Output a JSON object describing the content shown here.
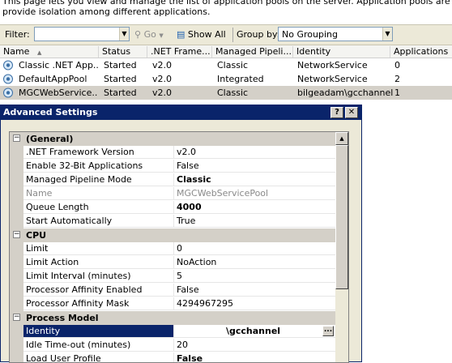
{
  "intro": {
    "line1": "This page lets you view and manage the list of application pools on the server. Application pools are associated with",
    "line2": "provide isolation among different applications."
  },
  "toolbar": {
    "filter_label": "Filter:",
    "filter_value": "",
    "go_label": "Go",
    "show_all_label": "Show All",
    "group_by_label": "Group by:",
    "group_by_value": "No Grouping"
  },
  "list": {
    "columns": [
      "Name",
      "Status",
      ".NET Frame...",
      "Managed Pipeli...",
      "Identity",
      "Applications"
    ],
    "rows": [
      {
        "name": "Classic .NET App...",
        "status": "Started",
        "framework": "v2.0",
        "pipeline": "Classic",
        "identity": "NetworkService",
        "applications": "0"
      },
      {
        "name": "DefaultAppPool",
        "status": "Started",
        "framework": "v2.0",
        "pipeline": "Integrated",
        "identity": "NetworkService",
        "applications": "2"
      },
      {
        "name": "MGCWebService...",
        "status": "Started",
        "framework": "v2.0",
        "pipeline": "Classic",
        "identity": "bilgeadam\\gcchannel",
        "applications": "1"
      }
    ]
  },
  "dialog": {
    "title": "Advanced Settings",
    "help_glyph": "?",
    "close_glyph": "✕",
    "categories": {
      "general": "(General)",
      "cpu": "CPU",
      "process_model": "Process Model"
    },
    "general": [
      {
        "name": ".NET Framework Version",
        "value": "v2.0"
      },
      {
        "name": "Enable 32-Bit Applications",
        "value": "False"
      },
      {
        "name": "Managed Pipeline Mode",
        "value": "Classic"
      },
      {
        "name": "Name",
        "value": "MGCWebServicePool"
      },
      {
        "name": "Queue Length",
        "value": "4000"
      },
      {
        "name": "Start Automatically",
        "value": "True"
      }
    ],
    "cpu": [
      {
        "name": "Limit",
        "value": "0"
      },
      {
        "name": "Limit Action",
        "value": "NoAction"
      },
      {
        "name": "Limit Interval (minutes)",
        "value": "5"
      },
      {
        "name": "Processor Affinity Enabled",
        "value": "False"
      },
      {
        "name": "Processor Affinity Mask",
        "value": "4294967295"
      }
    ],
    "process_model": [
      {
        "name": "Identity",
        "value": "\\gcchannel"
      },
      {
        "name": "Idle Time-out (minutes)",
        "value": "20"
      },
      {
        "name": "Load User Profile",
        "value": "False"
      }
    ]
  },
  "colors": {
    "selection": "#0a246a",
    "chrome": "#ece9d8"
  }
}
